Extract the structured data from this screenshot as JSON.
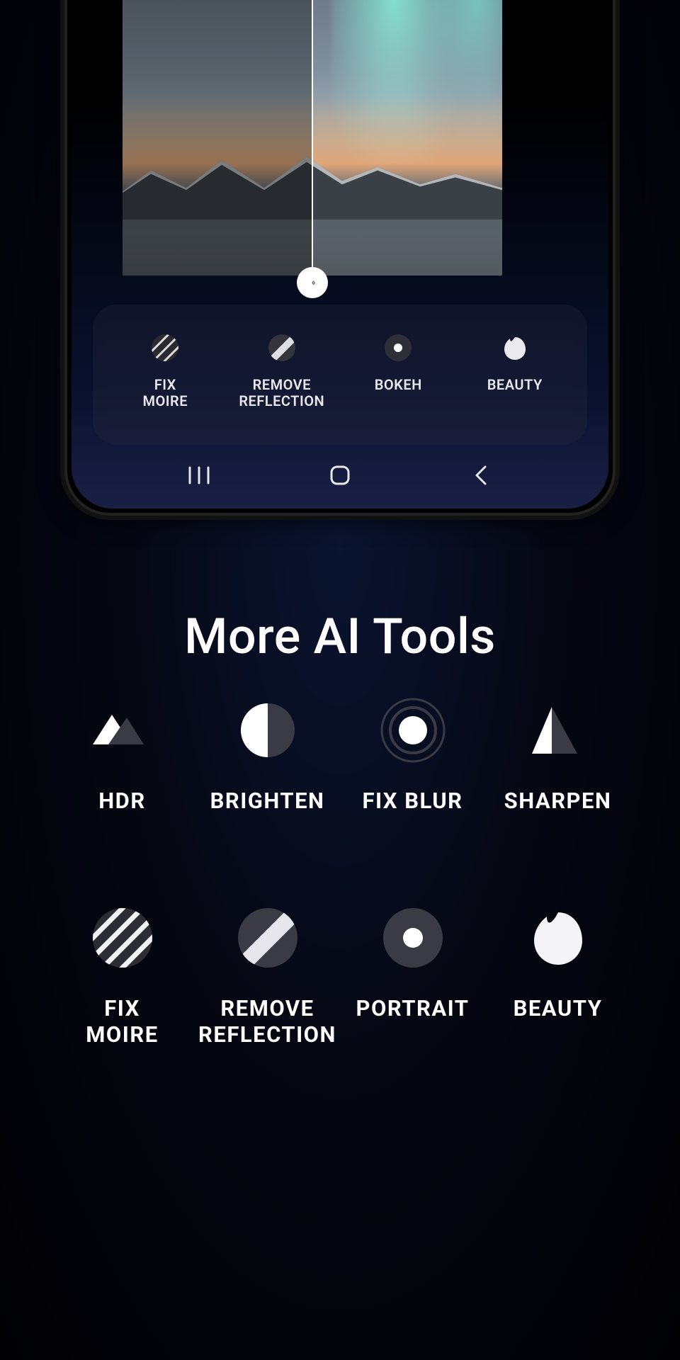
{
  "phone": {
    "slider_glyph": "‹ ›",
    "tray": [
      {
        "label": "FIX\nMOIRE",
        "icon": "fix-moire"
      },
      {
        "label": "REMOVE\nREFLECTION",
        "icon": "remove-reflection"
      },
      {
        "label": "BOKEH",
        "icon": "bokeh"
      },
      {
        "label": "BEAUTY",
        "icon": "beauty"
      }
    ]
  },
  "section_title": "More AI Tools",
  "tools": [
    {
      "label": "HDR",
      "icon": "hdr"
    },
    {
      "label": "BRIGHTEN",
      "icon": "brighten"
    },
    {
      "label": "FIX BLUR",
      "icon": "fix-blur"
    },
    {
      "label": "SHARPEN",
      "icon": "sharpen"
    },
    {
      "label": "FIX\nMOIRE",
      "icon": "fix-moire"
    },
    {
      "label": "REMOVE\nREFLECTION",
      "icon": "remove-reflection"
    },
    {
      "label": "PORTRAIT",
      "icon": "portrait"
    },
    {
      "label": "BEAUTY",
      "icon": "beauty"
    }
  ]
}
